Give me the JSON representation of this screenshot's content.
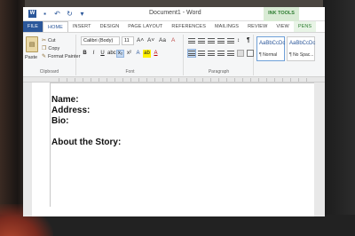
{
  "window": {
    "title": "Document1 - Word",
    "tools_tab": "INK TOOLS"
  },
  "tabs": [
    {
      "label": "FILE"
    },
    {
      "label": "HOME"
    },
    {
      "label": "INSERT"
    },
    {
      "label": "DESIGN"
    },
    {
      "label": "PAGE LAYOUT"
    },
    {
      "label": "REFERENCES"
    },
    {
      "label": "MAILINGS"
    },
    {
      "label": "REVIEW"
    },
    {
      "label": "VIEW"
    },
    {
      "label": "PENS"
    }
  ],
  "clipboard": {
    "paste": "Paste",
    "cut": "Cut",
    "copy": "Copy",
    "format_painter": "Format Painter",
    "group_label": "Clipboard"
  },
  "font": {
    "name": "Calibri (Body)",
    "size": "11",
    "group_label": "Font"
  },
  "paragraph": {
    "group_label": "Paragraph"
  },
  "styles": [
    {
      "sample": "AaBbCcDc",
      "name": "¶ Normal"
    },
    {
      "sample": "AaBbCcDc",
      "name": "¶ No Spac..."
    }
  ],
  "document": {
    "lines": [
      "Name:",
      "Address:",
      "Bio:",
      "About the Story:"
    ]
  },
  "colors": {
    "accent": "#2b579a",
    "pens_tab": "#2e7d32"
  }
}
